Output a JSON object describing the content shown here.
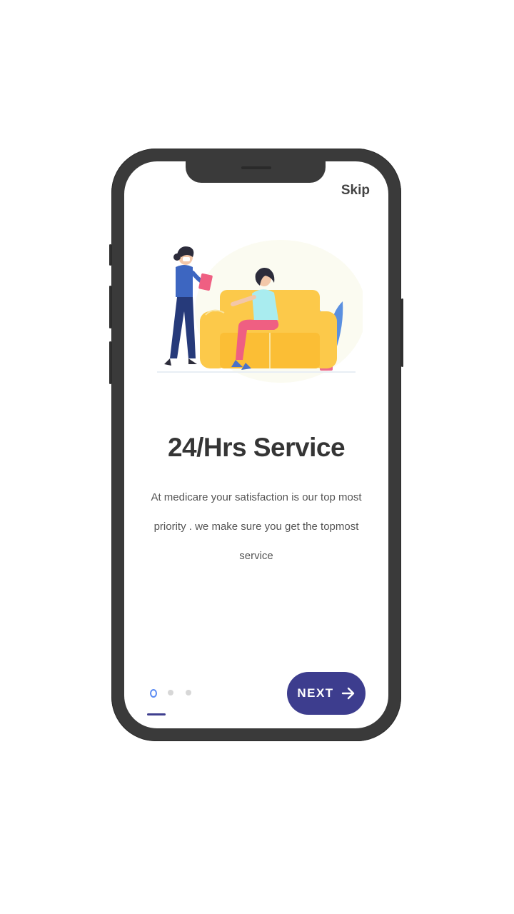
{
  "header": {
    "skip_label": "Skip"
  },
  "onboarding": {
    "title": "24/Hrs Service",
    "description": "At medicare your satisfaction is our top most priority . we make sure you get the topmost service",
    "illustration_icon": "doctor-patient-illustration",
    "page_indicator": {
      "total": 3,
      "active_index": 0
    }
  },
  "footer": {
    "next_label": "NEXT",
    "next_icon": "arrow-right-icon"
  },
  "colors": {
    "accent": "#3d3d8e",
    "active_dot": "#5b8bf2",
    "inactive_dot": "#d7d7d7",
    "title": "#353535"
  }
}
